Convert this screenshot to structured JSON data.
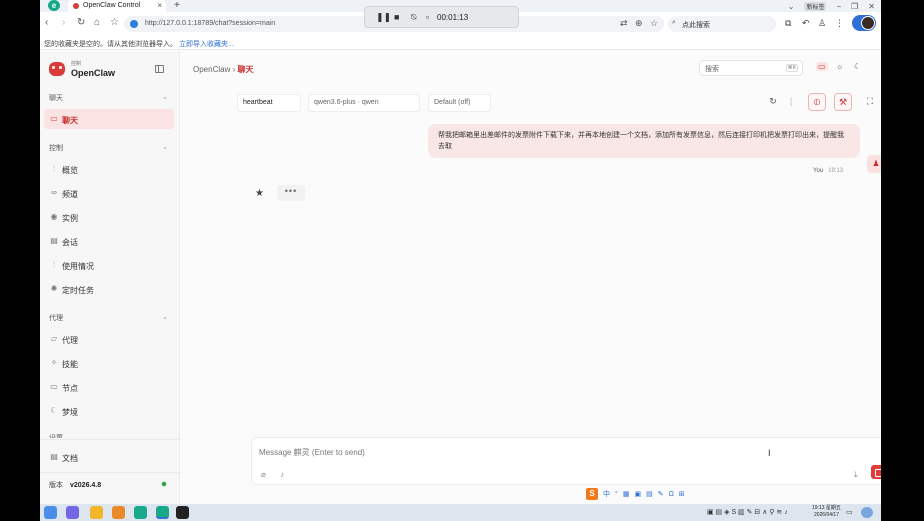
{
  "browser": {
    "tab_title": "OpenClaw Control",
    "tab_close": "×",
    "new_tab": "+",
    "profile_label": "新标签",
    "url": "http://127.0.0.1:18789/chat?session=main",
    "search_placeholder": "点此搜索",
    "bookmark_message": "您的收藏夹是空的。请从其他浏览器导入。",
    "bookmark_link": "立即导入收藏夹..."
  },
  "recorder": {
    "time": "00:01:13"
  },
  "sidebar": {
    "brand_small": "控制",
    "brand_name": "OpenClaw",
    "sections": [
      {
        "title": "聊天",
        "items": [
          {
            "label": "聊天",
            "icon": "chat-icon",
            "active": true
          }
        ]
      },
      {
        "title": "控制",
        "items": [
          {
            "label": "概览",
            "icon": "bar-chart-icon"
          },
          {
            "label": "频道",
            "icon": "link-icon"
          },
          {
            "label": "实例",
            "icon": "broadcast-icon"
          },
          {
            "label": "会话",
            "icon": "document-icon"
          },
          {
            "label": "使用情况",
            "icon": "bar-chart-icon"
          },
          {
            "label": "定时任务",
            "icon": "spinner-icon"
          }
        ]
      },
      {
        "title": "代理",
        "items": [
          {
            "label": "代理",
            "icon": "folder-icon"
          },
          {
            "label": "技能",
            "icon": "sparkle-icon"
          },
          {
            "label": "节点",
            "icon": "monitor-icon"
          },
          {
            "label": "梦境",
            "icon": "moon-icon"
          }
        ]
      },
      {
        "title": "设置"
      }
    ],
    "docs_label": "文档",
    "version_label": "版本",
    "version_value": "v2026.4.8"
  },
  "header": {
    "breadcrumb_root": "OpenClaw",
    "breadcrumb_sep": "›",
    "breadcrumb_current": "聊天",
    "search_placeholder": "搜索",
    "search_shortcut": "⌘K"
  },
  "chat_controls": {
    "session": "heartbeat",
    "model": "qwen3.6-plus · qwen",
    "thinking": "Default (off)"
  },
  "messages": [
    {
      "role": "user",
      "text": "帮我把邮箱里出差邮件的发票附件下载下来，并再本地创建一个文档，添加所有发票信息，然后连接打印机把发票打印出来，提醒我去取",
      "sender": "You",
      "time": "19:13"
    }
  ],
  "composer": {
    "placeholder": "Message 麒灵 (Enter to send)"
  },
  "taskbar": {
    "clock_time": "19:13 星期五",
    "clock_date": "2026/04/17"
  },
  "colors": {
    "accent": "#d93b3b",
    "accent_light": "#fbe3e3",
    "status_ok": "#2e9d45"
  }
}
